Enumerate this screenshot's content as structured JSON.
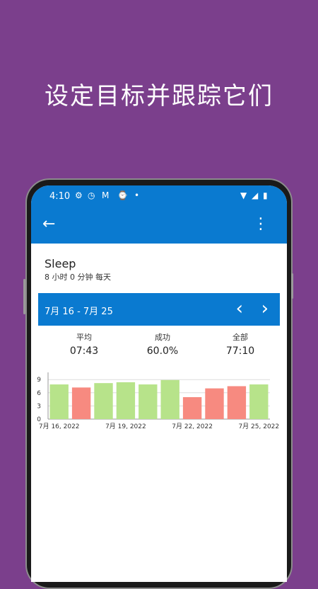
{
  "promo": {
    "headline": "设定目标并跟踪它们"
  },
  "statusbar": {
    "time": "4:10"
  },
  "habit": {
    "name": "Sleep",
    "detail": "8 小时 0 分钟  每天"
  },
  "date_range": {
    "label": "7月 16 - 7月 25"
  },
  "stats": [
    {
      "label": "平均",
      "value": "07:43"
    },
    {
      "label": "成功",
      "value": "60.0%"
    },
    {
      "label": "全部",
      "value": "77:10"
    }
  ],
  "colors": {
    "purple": "#7b3f8c",
    "blue": "#0a7ad0",
    "success": "#b7e38a",
    "fail": "#f78a80"
  },
  "chart_data": {
    "type": "bar",
    "categories": [
      "7月 16",
      "7月 17",
      "7月 18",
      "7月 19",
      "7月 20",
      "7月 21",
      "7月 22",
      "7月 23",
      "7月 24",
      "7月 25"
    ],
    "values": [
      7.9,
      7.2,
      8.2,
      8.4,
      7.9,
      8.9,
      5.0,
      7.0,
      7.5,
      7.9
    ],
    "success": [
      true,
      false,
      true,
      true,
      true,
      true,
      false,
      false,
      false,
      true
    ],
    "yticks": [
      "0",
      "3",
      "6",
      "9"
    ],
    "ylim": [
      0,
      10
    ],
    "xtick_labels": [
      {
        "index": 0,
        "label": "7月 16, 2022"
      },
      {
        "index": 3,
        "label": "7月 19, 2022"
      },
      {
        "index": 6,
        "label": "7月 22, 2022"
      },
      {
        "index": 9,
        "label": "7月 25, 2022"
      }
    ],
    "grid": true
  }
}
